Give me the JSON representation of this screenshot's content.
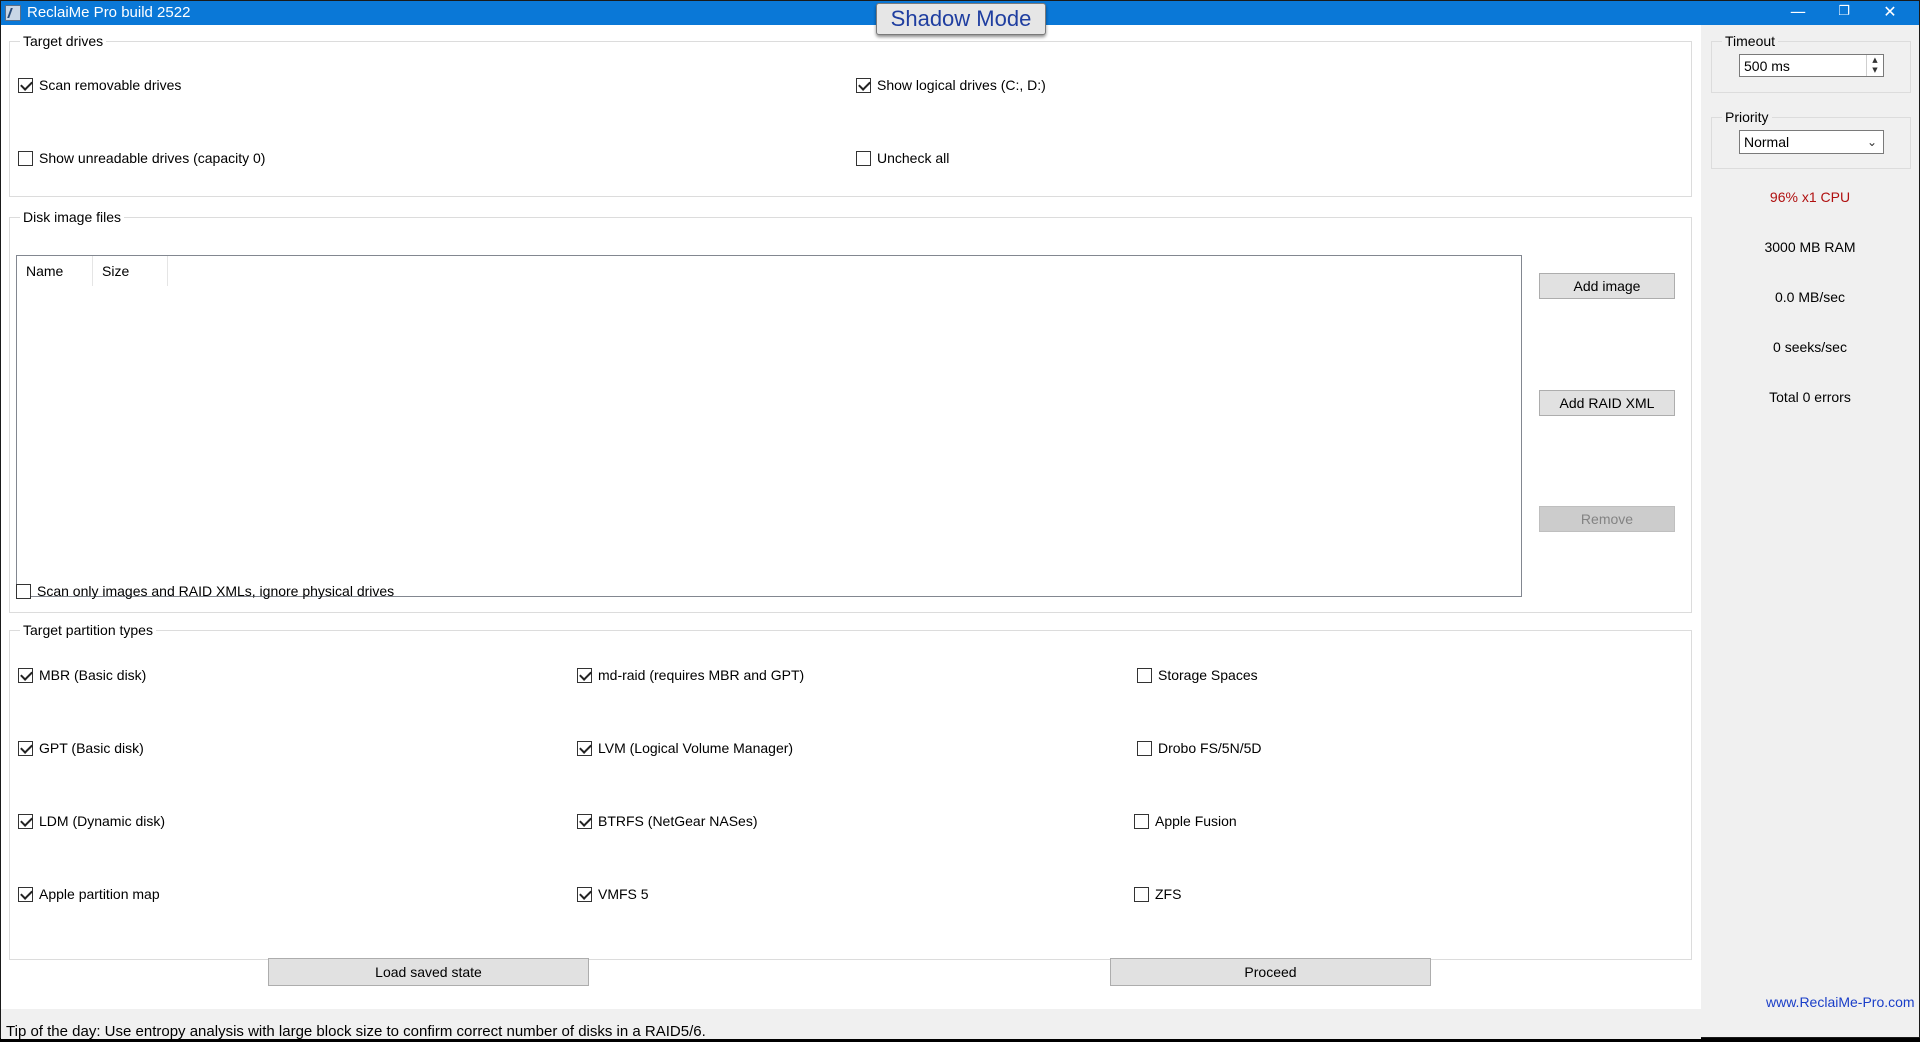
{
  "window": {
    "title": "ReclaiMe Pro build 2522",
    "shadow_mode_label": "Shadow Mode",
    "controls": {
      "minimize": "—",
      "maximize": "❐",
      "close": "✕"
    }
  },
  "target_drives": {
    "label": "Target drives",
    "options": [
      {
        "label": "Scan removable drives",
        "checked": true
      },
      {
        "label": "Show logical drives (C:, D:)",
        "checked": true
      },
      {
        "label": "Show unreadable drives (capacity 0)",
        "checked": false
      },
      {
        "label": "Uncheck all",
        "checked": false
      }
    ]
  },
  "disk_images": {
    "label": "Disk image files",
    "columns": [
      "Name",
      "Size"
    ],
    "rows": [],
    "add_image_label": "Add image",
    "add_raid_xml_label": "Add RAID XML",
    "remove_label": "Remove",
    "scan_only_label": "Scan only images and RAID XMLs, ignore physical drives",
    "scan_only_checked": false
  },
  "partition_types": {
    "label": "Target partition types",
    "options": [
      {
        "label": "MBR (Basic disk)",
        "checked": true
      },
      {
        "label": "GPT (Basic disk)",
        "checked": true
      },
      {
        "label": "LDM (Dynamic disk)",
        "checked": true
      },
      {
        "label": "Apple partition map",
        "checked": true
      },
      {
        "label": "md-raid (requires MBR and GPT)",
        "checked": true
      },
      {
        "label": "LVM (Logical Volume Manager)",
        "checked": true
      },
      {
        "label": "BTRFS (NetGear NASes)",
        "checked": true
      },
      {
        "label": "VMFS 5",
        "checked": true
      },
      {
        "label": "Storage Spaces",
        "checked": false
      },
      {
        "label": "Drobo FS/5N/5D",
        "checked": false
      },
      {
        "label": "Apple Fusion",
        "checked": false
      },
      {
        "label": "ZFS",
        "checked": false
      }
    ]
  },
  "actions": {
    "load_saved_state_label": "Load saved state",
    "proceed_label": "Proceed"
  },
  "side": {
    "timeout_label": "Timeout",
    "timeout_value": "500 ms",
    "priority_label": "Priority",
    "priority_value": "Normal",
    "cpu": "96% x1 CPU",
    "cpu_color": "#b01010",
    "ram": "3000 MB RAM",
    "speed": "0.0 MB/sec",
    "seeks": "0 seeks/sec",
    "errors": "Total 0 errors",
    "website": "www.ReclaiMe-Pro.com"
  },
  "status": {
    "tip": "Tip of the day: Use entropy analysis with large block size to confirm correct number of disks in a RAID5/6."
  },
  "colors": {
    "titlebar": "#0a78d7",
    "shadow_mode_text": "#1f3ea0",
    "link": "#1a3ec8"
  }
}
